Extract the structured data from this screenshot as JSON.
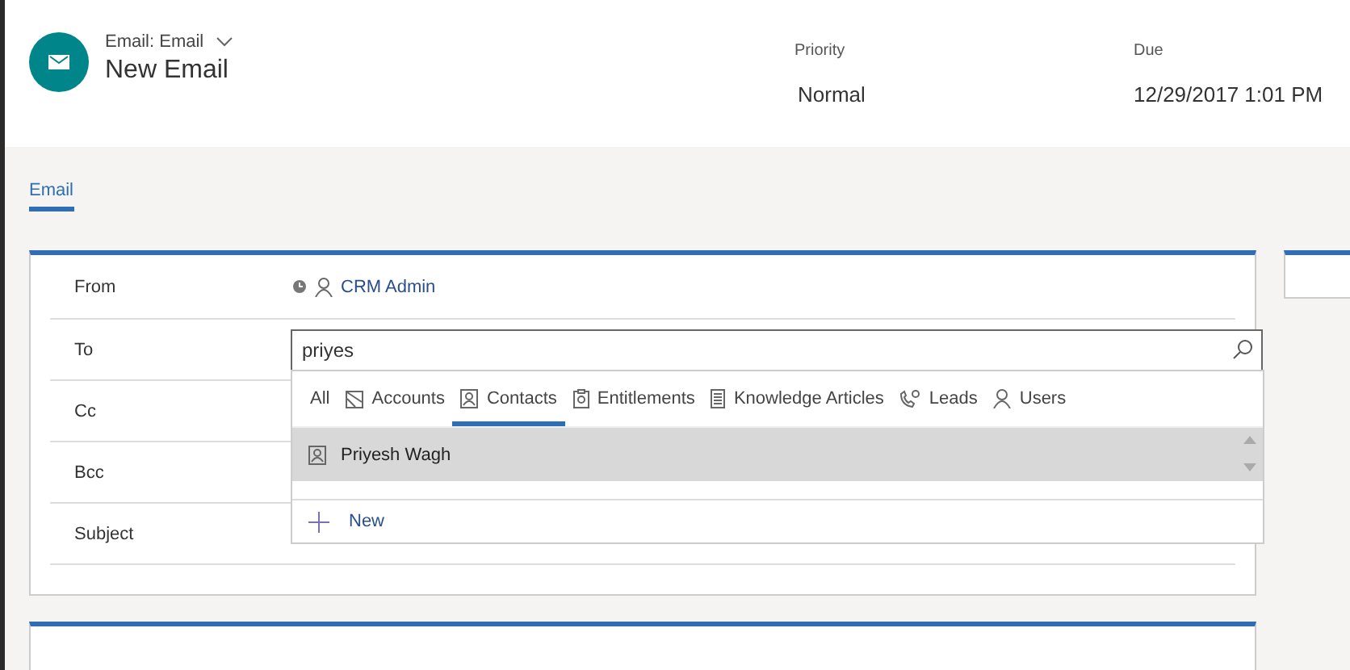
{
  "record": {
    "type_label": "Email: Email",
    "title": "New Email"
  },
  "header_fields": [
    {
      "label": "Priority",
      "value": "Normal"
    },
    {
      "label": "Due",
      "value": "12/29/2017 1:01 PM"
    }
  ],
  "tabs": [
    {
      "label": "Email",
      "selected": true
    }
  ],
  "form_rows": [
    {
      "label": "From",
      "kind": "lookup",
      "value": "CRM Admin"
    },
    {
      "label": "To",
      "kind": "search",
      "value": "priyes"
    },
    {
      "label": "Cc",
      "kind": "empty"
    },
    {
      "label": "Bcc",
      "kind": "empty"
    },
    {
      "label": "Subject",
      "kind": "empty"
    }
  ],
  "lookup_dropdown": {
    "filters": [
      {
        "label": "All",
        "kind": "all",
        "selected": false
      },
      {
        "label": "Accounts",
        "kind": "account",
        "selected": false
      },
      {
        "label": "Contacts",
        "kind": "contact",
        "selected": true
      },
      {
        "label": "Entitlements",
        "kind": "entitlement",
        "selected": false
      },
      {
        "label": "Knowledge Articles",
        "kind": "article",
        "selected": false
      },
      {
        "label": "Leads",
        "kind": "lead",
        "selected": false
      },
      {
        "label": "Users",
        "kind": "user",
        "selected": false
      }
    ],
    "results": [
      {
        "name": "Priyesh Wagh",
        "selected": true
      }
    ],
    "new_label": "New"
  }
}
